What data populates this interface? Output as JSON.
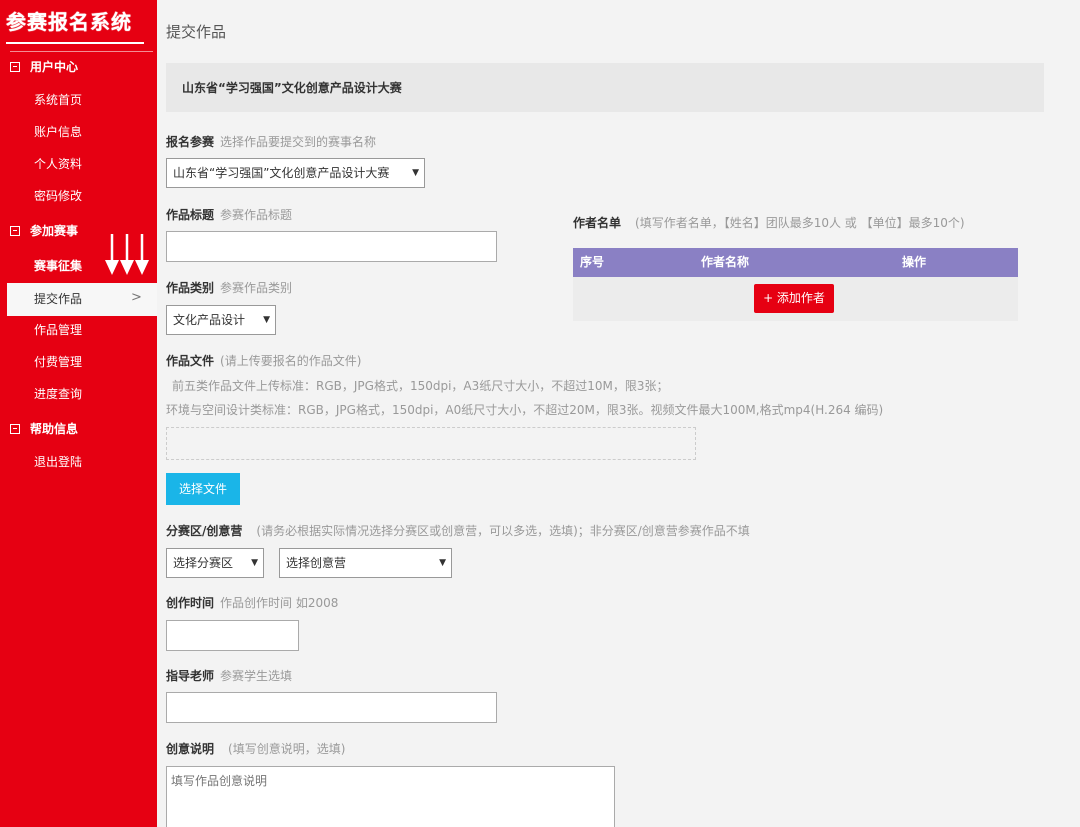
{
  "sidebar": {
    "logo": "参赛报名系统",
    "groups": [
      {
        "title": "用户中心",
        "items": [
          "系统首页",
          "账户信息",
          "个人资料",
          "密码修改"
        ]
      },
      {
        "title": "参加赛事",
        "items": [
          "赛事征集",
          "提交作品",
          "作品管理",
          "付费管理",
          "进度查询"
        ]
      },
      {
        "title": "帮助信息",
        "items": [
          "退出登陆"
        ]
      }
    ],
    "active_item": "提交作品",
    "active_chevron": ">"
  },
  "main": {
    "page_title": "提交作品",
    "contest_banner": "山东省“学习强国”文化创意产品设计大赛",
    "contest_select": {
      "label": "报名参赛",
      "hint": "选择作品要提交到的赛事名称",
      "value": "山东省“学习强国”文化创意产品设计大赛"
    },
    "title_field": {
      "label": "作品标题",
      "hint": "参赛作品标题",
      "value": ""
    },
    "category_field": {
      "label": "作品类别",
      "hint": "参赛作品类别",
      "value": "文化产品设计"
    },
    "file_field": {
      "label": "作品文件",
      "hint": "(请上传要报名的作品文件)",
      "line1": "前五类作品文件上传标准：RGB，JPG格式，150dpi，A3纸尺寸大小，不超过10M，限3张；",
      "line2": "环境与空间设计类标准：RGB，JPG格式，150dpi，A0纸尺寸大小，不超过20M，限3张。视频文件最大100M,格式mp4(H.264 编码)",
      "button": "选择文件"
    },
    "division_field": {
      "label": "分赛区/创意营",
      "hint": "(请务必根据实际情况选择分赛区或创意营，可以多选，选填)；非分赛区/创意营参赛作品不填",
      "division_value": "选择分赛区",
      "camp_value": "选择创意营"
    },
    "year_field": {
      "label": "创作时间",
      "hint": "作品创作时间 如2008",
      "value": ""
    },
    "teacher_field": {
      "label": "指导老师",
      "hint": "参赛学生选填",
      "value": ""
    },
    "idea_field": {
      "label": "创意说明",
      "hint": "(填写创意说明，选填)",
      "placeholder": "填写作品创意说明"
    },
    "authors": {
      "label": "作者名单",
      "hint": "(填写作者名单，【姓名】团队最多10人 或 【单位】最多10个)",
      "columns": [
        "序号",
        "作者名称",
        "操作"
      ],
      "add_button": "+ 添加作者"
    }
  },
  "colors": {
    "brand_red": "#e60012",
    "table_header": "#8a80c4",
    "upload_button": "#1ab5e8"
  }
}
